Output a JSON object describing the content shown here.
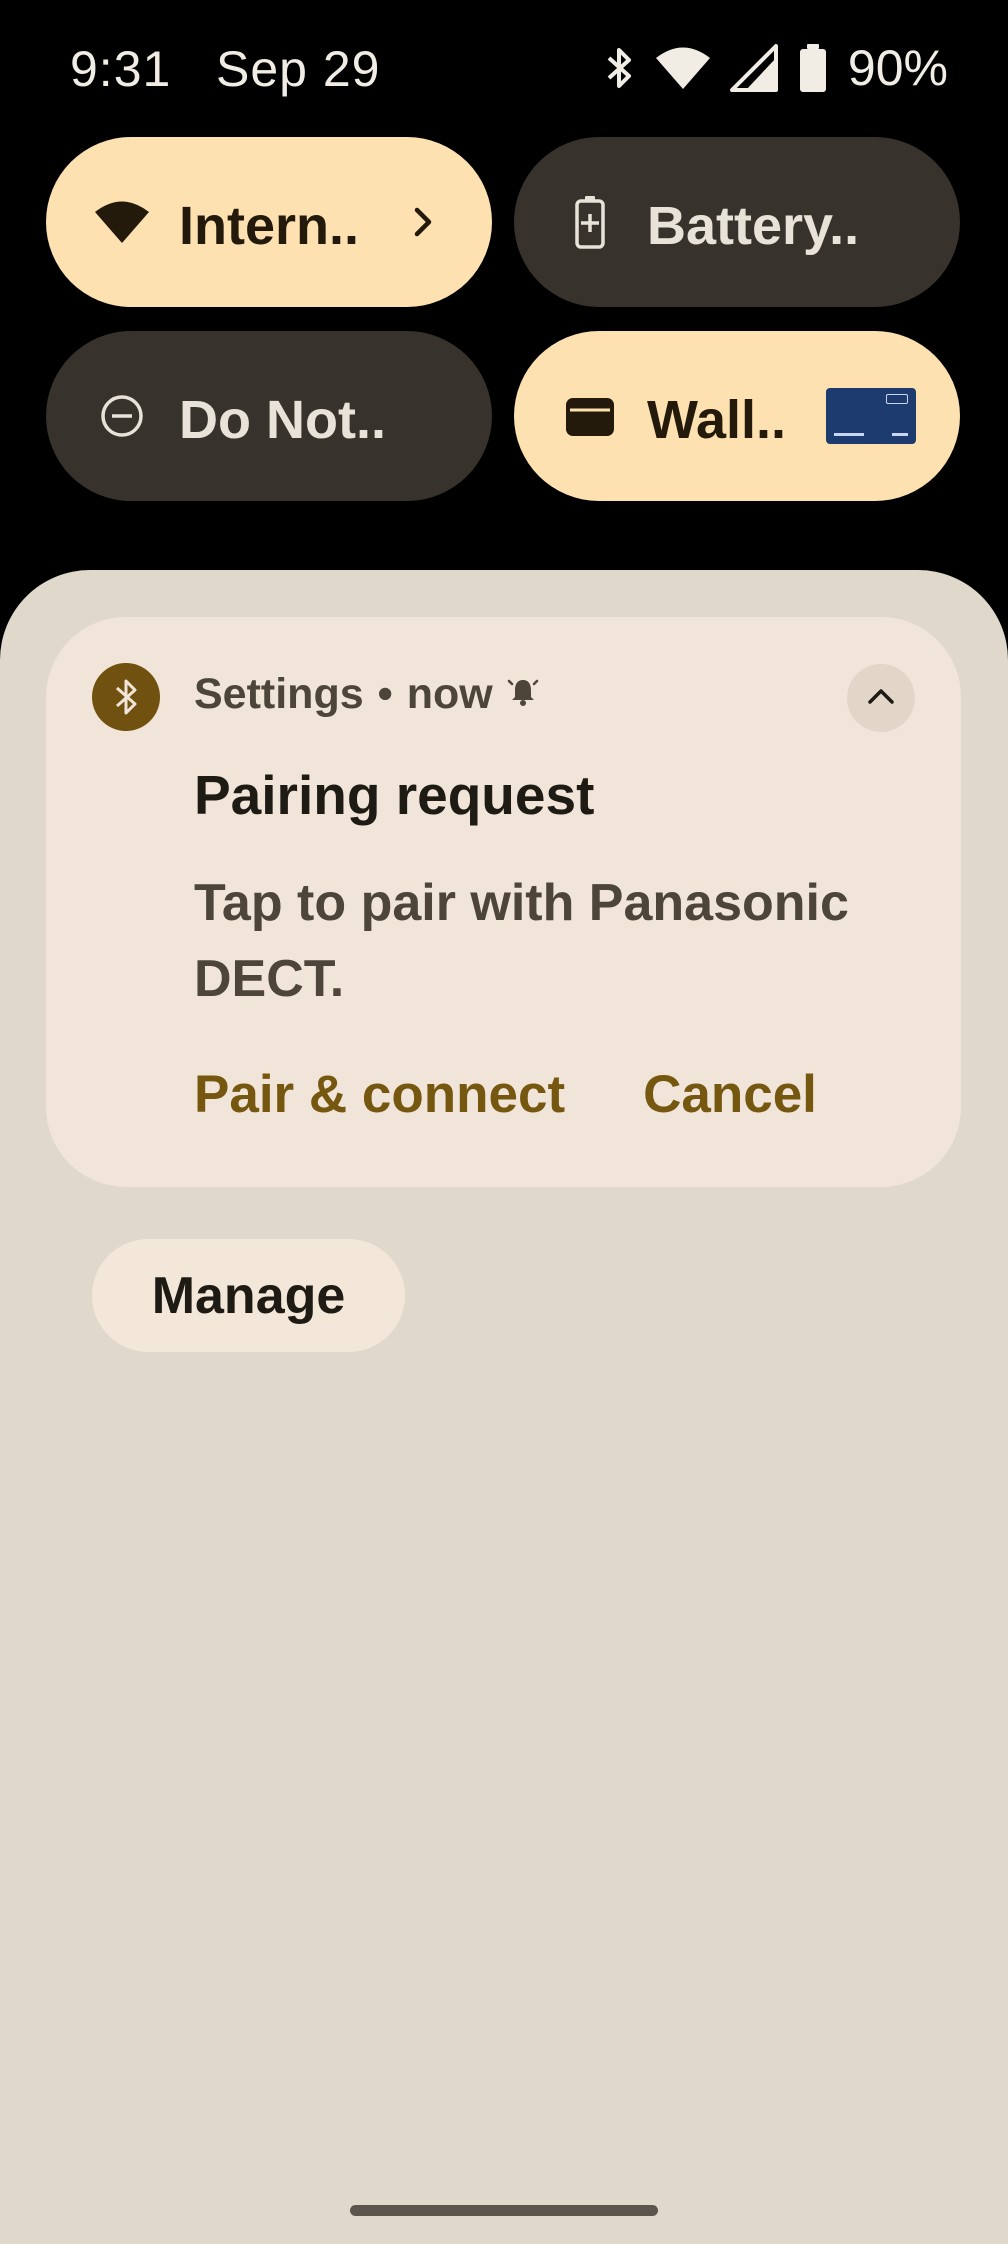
{
  "status_bar": {
    "time": "9:31",
    "date": "Sep 29",
    "battery_percent": "90%",
    "icons": [
      "bluetooth-icon",
      "wifi-icon",
      "cell-signal-icon",
      "battery-icon"
    ]
  },
  "quick_tiles": [
    {
      "label": "Intern..",
      "icon": "wifi-icon",
      "state": "on",
      "has_chevron": true
    },
    {
      "label": "Battery..",
      "icon": "battery-saver-icon",
      "state": "off"
    },
    {
      "label": "Do Not..",
      "icon": "do-not-disturb-icon",
      "state": "off"
    },
    {
      "label": "Wall..",
      "icon": "wallet-icon",
      "state": "on",
      "has_card_preview": true
    }
  ],
  "notification": {
    "app_icon": "bluetooth-icon",
    "app_name": "Settings",
    "separator": "•",
    "time": "now",
    "alert_icon": "bell-icon",
    "title": "Pairing request",
    "text": "Tap to pair with Panasonic DECT.",
    "actions": [
      "Pair & connect",
      "Cancel"
    ],
    "expanded": true
  },
  "manage_button": {
    "label": "Manage"
  },
  "colors": {
    "shade_bg": "#e1d8cc",
    "notification_bg": "#f0e5d8",
    "tile_on": "#fde1b0",
    "tile_off": "#37322b",
    "accent": "#765710"
  }
}
